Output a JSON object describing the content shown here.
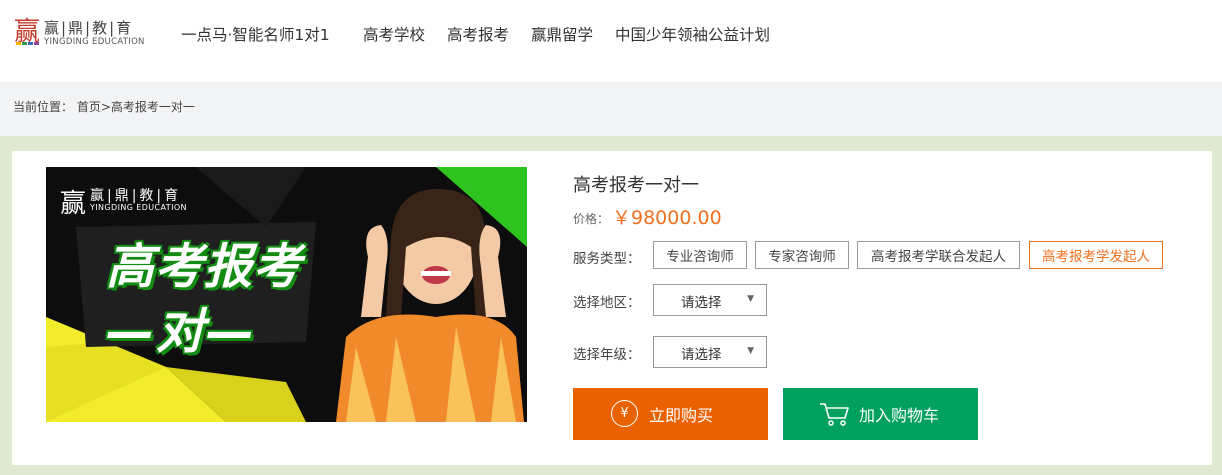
{
  "logo": {
    "cn": "赢|鼎|教|育",
    "en": "YINGDING EDUCATION",
    "mark_colors": [
      "#e63c2f",
      "#f4b400",
      "#2c9b4c",
      "#2f6db5",
      "#8e44ad"
    ]
  },
  "nav": {
    "items": [
      "一点马·智能名师1对1",
      "高考学校",
      "高考报考",
      "赢鼎留学",
      "中国少年领袖公益计划"
    ]
  },
  "breadcrumb": {
    "prefix": "当前位置：",
    "home": "首页",
    "sep": ">",
    "current": "高考报考一对一"
  },
  "banner": {
    "logo_glyph": "赢",
    "logo_cn": "赢|鼎|教|育",
    "logo_en": "YINGDING EDUCATION",
    "title": "高考报考",
    "subtitle": "—对—",
    "colors": {
      "green": "#2ec31f",
      "yellow": "#f3ec2a",
      "dark": "#0d0d0d"
    }
  },
  "product": {
    "title": "高考报考一对一",
    "price_label": "价格：",
    "price": "￥98000.00",
    "service_label": "服务类型：",
    "service_options": [
      "专业咨询师",
      "专家咨询师",
      "高考报考学联合发起人",
      "高考报考学发起人"
    ],
    "service_selected": "高考报考学发起人",
    "region_label": "选择地区：",
    "region_value": "请选择",
    "grade_label": "选择年级：",
    "grade_value": "请选择",
    "buy_icon": "¥",
    "buy_label": "立即购买",
    "cart_label": "加入购物车"
  },
  "colors": {
    "accent": "#ea6100",
    "green": "#00a15e",
    "page_bg": "#e0ead2",
    "crumb_bg": "#f3f4f6",
    "price": "#f07020"
  }
}
